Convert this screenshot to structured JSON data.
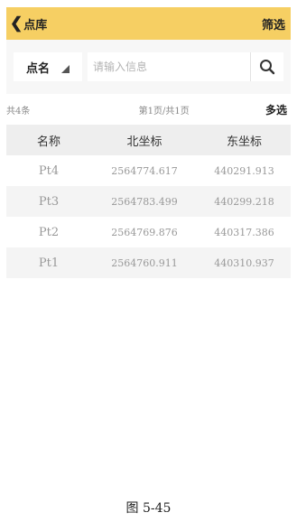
{
  "header": {
    "back_label": "点库",
    "filter_label": "筛选"
  },
  "search": {
    "type_label": "点名",
    "placeholder": "请输入信息"
  },
  "info": {
    "count": "共4条",
    "page": "第1页/共1页",
    "multi_select": "多选"
  },
  "table": {
    "headers": [
      "名称",
      "北坐标",
      "东坐标"
    ],
    "rows": [
      [
        "Pt4",
        "2564774.617",
        "440291.913"
      ],
      [
        "Pt3",
        "2564783.499",
        "440299.218"
      ],
      [
        "Pt2",
        "2564769.876",
        "440317.386"
      ],
      [
        "Pt1",
        "2564760.911",
        "440310.937"
      ]
    ]
  },
  "caption": "图 5-45",
  "colors": {
    "header_bg": "#f6cf63",
    "table_head_bg": "#eeeeee"
  },
  "icons": {
    "back": "chevron-left-icon",
    "search": "search-icon",
    "dropdown": "dropdown-triangle-icon"
  }
}
